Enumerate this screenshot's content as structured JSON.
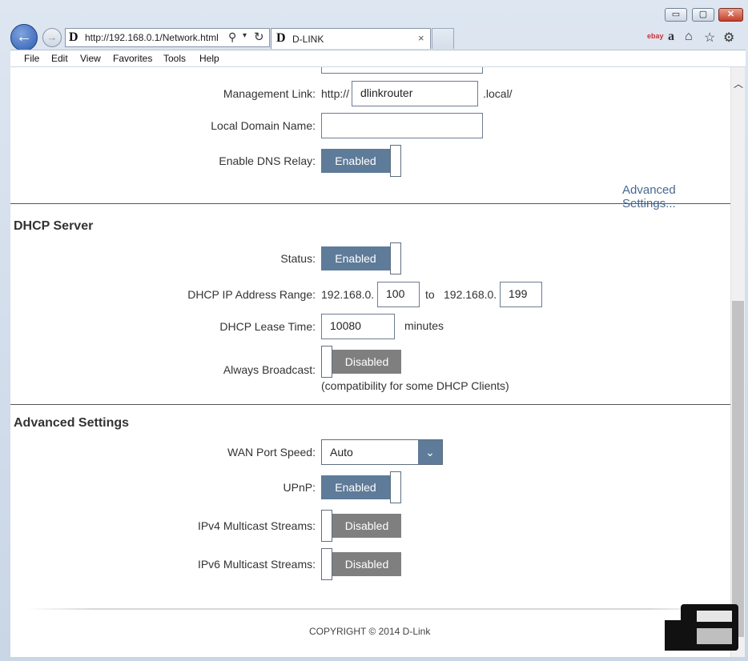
{
  "browser": {
    "window_buttons": {
      "minimize": "▭",
      "maximize": "▢",
      "close": "✕"
    },
    "url": "http://192.168.0.1/Network.html",
    "tab_title": "D-LINK",
    "favicon_letter": "D",
    "tab_close": "×",
    "ebay": "ebay",
    "amazon": "a",
    "menu": [
      "File",
      "Edit",
      "View",
      "Favorites",
      "Tools",
      "Help"
    ]
  },
  "network": {
    "management_link_label": "Management Link:",
    "management_link_prefix": "http://",
    "management_link_value": "dlinkrouter",
    "management_link_suffix": ".local/",
    "local_domain_label": "Local Domain Name:",
    "local_domain_value": "",
    "dns_relay_label": "Enable DNS Relay:",
    "dns_relay_state": "Enabled",
    "advanced_link": "Advanced Settings..."
  },
  "dhcp": {
    "title": "DHCP Server",
    "status_label": "Status:",
    "status_state": "Enabled",
    "range_label": "DHCP IP Address Range:",
    "range_prefix_1": "192.168.0.",
    "range_start": "100",
    "range_to": "to",
    "range_prefix_2": "192.168.0.",
    "range_end": "199",
    "lease_label": "DHCP Lease Time:",
    "lease_value": "10080",
    "lease_unit": "minutes",
    "broadcast_label": "Always Broadcast:",
    "broadcast_state": "Disabled",
    "broadcast_note": "(compatibility for some DHCP Clients)"
  },
  "advanced": {
    "title": "Advanced Settings",
    "wan_label": "WAN Port Speed:",
    "wan_value": "Auto",
    "upnp_label": "UPnP:",
    "upnp_state": "Enabled",
    "ipv4_label": "IPv4 Multicast Streams:",
    "ipv4_state": "Disabled",
    "ipv6_label": "IPv6 Multicast Streams:",
    "ipv6_state": "Disabled"
  },
  "footer": {
    "copyright": "COPYRIGHT © 2014 D-Link"
  },
  "colors": {
    "enabled": "#5e7b99",
    "disabled": "#7f7f7f",
    "link": "#47698f"
  }
}
